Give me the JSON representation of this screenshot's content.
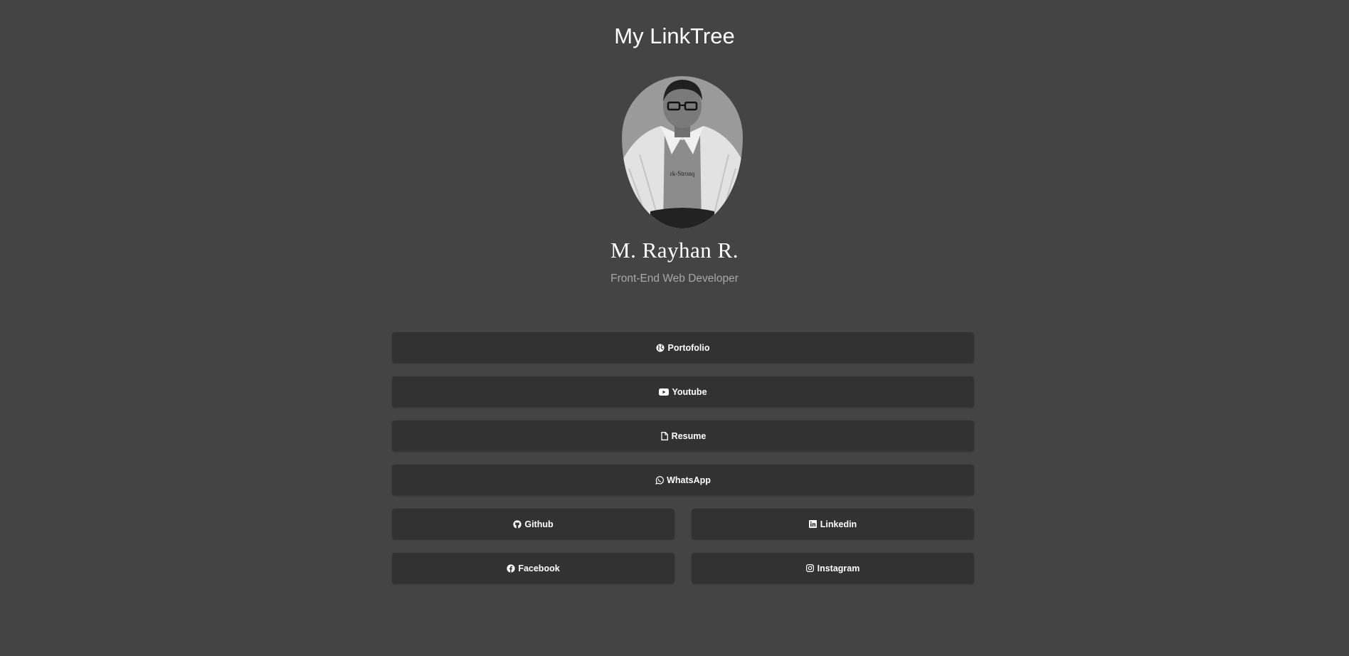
{
  "header": {
    "title": "My LinkTree"
  },
  "profile": {
    "name": "M. Rayhan R.",
    "role": "Front-End Web Developer",
    "avatar_icon": "profile-photo"
  },
  "links": {
    "portfolio": {
      "label": "Portofolio",
      "icon": "globe-icon"
    },
    "youtube": {
      "label": "Youtube",
      "icon": "youtube-icon"
    },
    "resume": {
      "label": "Resume",
      "icon": "file-icon"
    },
    "whatsapp": {
      "label": "WhatsApp",
      "icon": "whatsapp-icon"
    },
    "github": {
      "label": "Github",
      "icon": "github-icon"
    },
    "linkedin": {
      "label": "Linkedin",
      "icon": "linkedin-icon"
    },
    "facebook": {
      "label": "Facebook",
      "icon": "facebook-icon"
    },
    "instagram": {
      "label": "Instagram",
      "icon": "instagram-icon"
    }
  },
  "colors": {
    "background": "#444444",
    "button": "#323232",
    "text": "#ffffff",
    "muted": "#a8a8a8"
  }
}
